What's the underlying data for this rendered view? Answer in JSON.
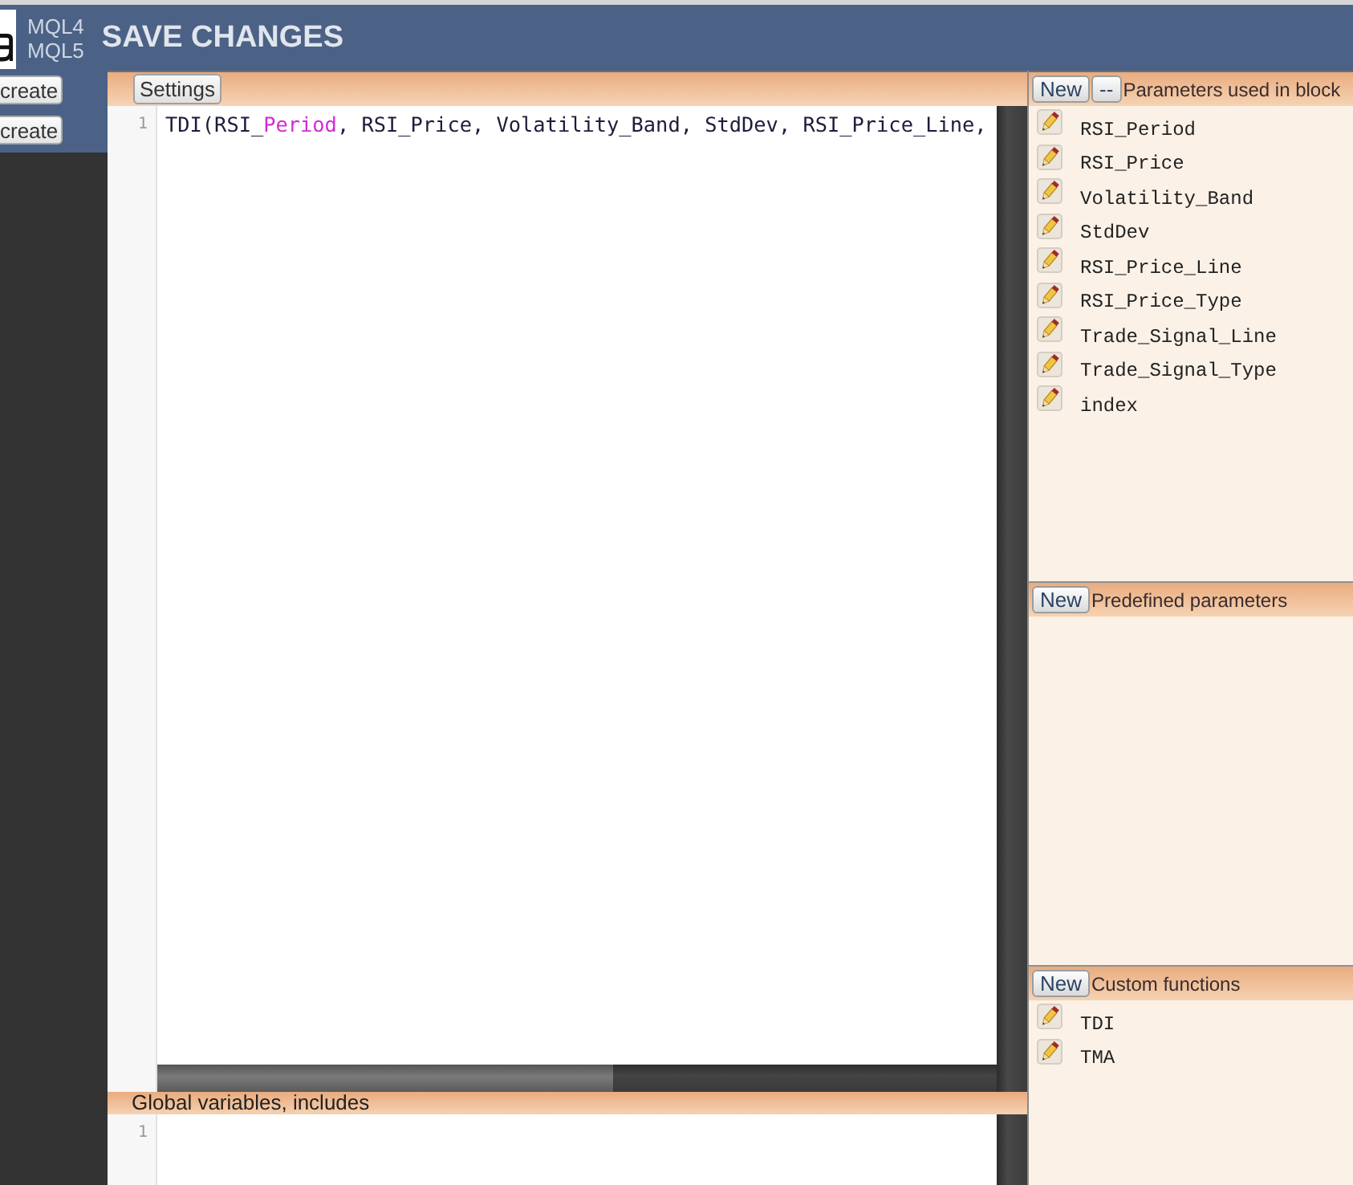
{
  "top_bar": {
    "languages": [
      "MQL4",
      "MQL5"
    ],
    "title": "SAVE CHANGES"
  },
  "sidebar": {
    "buttons": [
      "create",
      "create"
    ]
  },
  "editor": {
    "settings_button": "Settings",
    "lines": [
      {
        "number": "1",
        "tokens": [
          {
            "text": "TDI(RSI_",
            "kind": "plain"
          },
          {
            "text": "Period",
            "kind": "highlight"
          },
          {
            "text": ", RSI_Price, Volatility_Band, StdDev, RSI_Price_Line,",
            "kind": "plain"
          }
        ]
      }
    ]
  },
  "globals": {
    "title": "Global variables, includes",
    "lines": [
      {
        "number": "1"
      }
    ]
  },
  "side_panel": {
    "sections": [
      {
        "buttons": [
          "New",
          "--"
        ],
        "title": "Parameters used in block",
        "items": [
          "RSI_Period",
          "RSI_Price",
          "Volatility_Band",
          "StdDev",
          "RSI_Price_Line",
          "RSI_Price_Type",
          "Trade_Signal_Line",
          "Trade_Signal_Type",
          "index"
        ]
      },
      {
        "buttons": [
          "New"
        ],
        "title": "Predefined parameters"
      },
      {
        "buttons": [
          "New"
        ],
        "title": "Custom functions",
        "items": [
          "TDI",
          "TMA"
        ]
      }
    ]
  }
}
